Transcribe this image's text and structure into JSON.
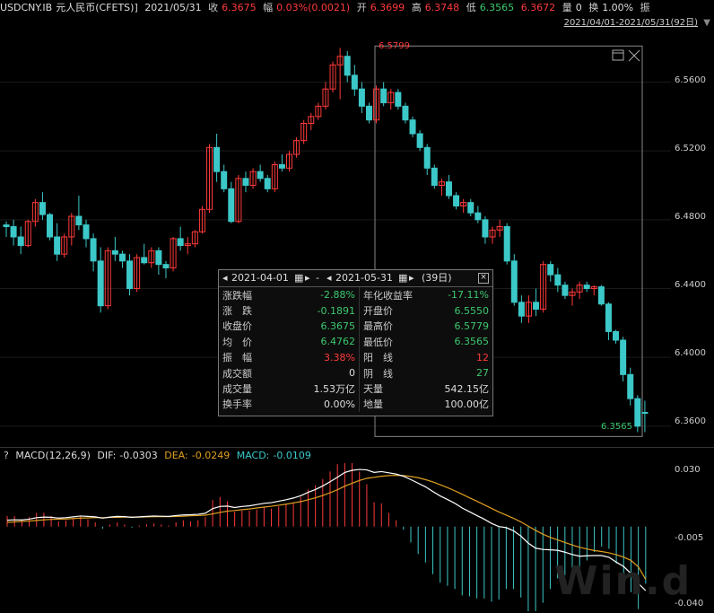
{
  "header": {
    "symbol": "USDCNY.IB",
    "name": "元人民币(CFETS)]",
    "date": "2021/05/31",
    "close_label": "收",
    "close_value": "6.3675",
    "change_label": "幅",
    "change_value": "0.03%(0.0021)",
    "open_label": "开",
    "open_value": "6.3699",
    "high_label": "高",
    "high_value": "6.3748",
    "low_label": "低",
    "low_value": "6.3565",
    "extra_value": "6.3672",
    "vol_label": "量",
    "vol_value": "0",
    "turn_label": "换",
    "turn_value": "1.00%",
    "amp_label": "振"
  },
  "range_subtitle": "2021/04/01-2021/05/31(92日)",
  "price_axis": [
    "6.5600",
    "6.5200",
    "6.4800",
    "6.4400",
    "6.4000",
    "6.3600"
  ],
  "high_marker": "6.5799",
  "low_marker": "6.3565",
  "macd_header": {
    "help": "?",
    "title": "MACD(12,26,9)",
    "dif_label": "DIF:",
    "dif_value": "-0.0303",
    "dea_label": "DEA:",
    "dea_value": "-0.0249",
    "macd_label": "MACD:",
    "macd_value": "-0.0109"
  },
  "macd_axis": [
    "0.030",
    "-0.005",
    "-0.040"
  ],
  "popup": {
    "start_date": "2021-04-01",
    "dash": "-",
    "end_date": "2021-05-31",
    "days": "(39日)",
    "rows": [
      {
        "k1": "涨跌幅",
        "v1": "-2.88%",
        "c1": "dn",
        "k2": "年化收益率",
        "v2": "-17.11%",
        "c2": "dn"
      },
      {
        "k1": "涨　跌",
        "v1": "-0.1891",
        "c1": "dn",
        "k2": "开盘价",
        "v2": "6.5550",
        "c2": "dn"
      },
      {
        "k1": "收盘价",
        "v1": "6.3675",
        "c1": "dn",
        "k2": "最高价",
        "v2": "6.5779",
        "c2": "dn"
      },
      {
        "k1": "均　价",
        "v1": "6.4762",
        "c1": "dn",
        "k2": "最低价",
        "v2": "6.3565",
        "c2": "dn"
      },
      {
        "k1": "振　幅",
        "v1": "3.38%",
        "c1": "up",
        "k2": "阳　线",
        "v2": "12",
        "c2": "up"
      },
      {
        "k1": "成交额",
        "v1": "0",
        "c1": "wht",
        "k2": "阴　线",
        "v2": "27",
        "c2": "dn"
      },
      {
        "k1": "成交量",
        "v1": "1.53万亿",
        "c1": "wht",
        "k2": "天量",
        "v2": "542.15亿",
        "c2": "wht"
      },
      {
        "k1": "换手率",
        "v1": "0.00%",
        "c1": "wht",
        "k2": "地量",
        "v2": "100.00亿",
        "c2": "wht"
      }
    ]
  },
  "watermark": "Win.d",
  "colors": {
    "up": "#ff3a3a",
    "down": "#3cc8c8",
    "dif": "#ffffff",
    "dea": "#e0a020"
  },
  "chart_data": {
    "type": "candlestick",
    "y_range": [
      6.35,
      6.59
    ],
    "candles": [
      [
        6.477,
        6.479,
        6.47,
        6.476
      ],
      [
        6.476,
        6.48,
        6.465,
        6.47
      ],
      [
        6.47,
        6.476,
        6.46,
        6.465
      ],
      [
        6.465,
        6.48,
        6.464,
        6.479
      ],
      [
        6.479,
        6.492,
        6.476,
        6.49
      ],
      [
        6.49,
        6.496,
        6.48,
        6.483
      ],
      [
        6.483,
        6.484,
        6.468,
        6.47
      ],
      [
        6.47,
        6.478,
        6.456,
        6.46
      ],
      [
        6.46,
        6.472,
        6.458,
        6.47
      ],
      [
        6.47,
        6.484,
        6.465,
        6.482
      ],
      [
        6.482,
        6.494,
        6.474,
        6.477
      ],
      [
        6.477,
        6.48,
        6.464,
        6.469
      ],
      [
        6.469,
        6.472,
        6.45,
        6.456
      ],
      [
        6.456,
        6.464,
        6.426,
        6.43
      ],
      [
        6.43,
        6.464,
        6.428,
        6.462
      ],
      [
        6.462,
        6.47,
        6.456,
        6.46
      ],
      [
        6.46,
        6.462,
        6.452,
        6.456
      ],
      [
        6.456,
        6.46,
        6.436,
        6.44
      ],
      [
        6.44,
        6.46,
        6.438,
        6.458
      ],
      [
        6.458,
        6.466,
        6.454,
        6.455
      ],
      [
        6.455,
        6.464,
        6.452,
        6.462
      ],
      [
        6.462,
        6.464,
        6.448,
        6.454
      ],
      [
        6.454,
        6.456,
        6.446,
        6.452
      ],
      [
        6.452,
        6.47,
        6.45,
        6.469
      ],
      [
        6.469,
        6.476,
        6.462,
        6.465
      ],
      [
        6.465,
        6.47,
        6.46,
        6.466
      ],
      [
        6.466,
        6.474,
        6.464,
        6.473
      ],
      [
        6.473,
        6.488,
        6.472,
        6.486
      ],
      [
        6.486,
        6.524,
        6.484,
        6.522
      ],
      [
        6.522,
        6.53,
        6.502,
        6.508
      ],
      [
        6.508,
        6.512,
        6.496,
        6.498
      ],
      [
        6.498,
        6.502,
        6.478,
        6.479
      ],
      [
        6.479,
        6.506,
        6.478,
        6.504
      ],
      [
        6.504,
        6.508,
        6.496,
        6.5
      ],
      [
        6.5,
        6.51,
        6.498,
        6.508
      ],
      [
        6.508,
        6.512,
        6.502,
        6.504
      ],
      [
        6.504,
        6.506,
        6.496,
        6.498
      ],
      [
        6.498,
        6.514,
        6.496,
        6.512
      ],
      [
        6.512,
        6.518,
        6.508,
        6.51
      ],
      [
        6.51,
        6.52,
        6.508,
        6.518
      ],
      [
        6.518,
        6.528,
        6.516,
        6.526
      ],
      [
        6.526,
        6.538,
        6.524,
        6.536
      ],
      [
        6.536,
        6.542,
        6.532,
        6.54
      ],
      [
        6.54,
        6.548,
        6.538,
        6.546
      ],
      [
        6.546,
        6.56,
        6.544,
        6.556
      ],
      [
        6.556,
        6.572,
        6.554,
        6.57
      ],
      [
        6.57,
        6.5799,
        6.55,
        6.575
      ],
      [
        6.575,
        6.578,
        6.56,
        6.564
      ],
      [
        6.564,
        6.57,
        6.552,
        6.556
      ],
      [
        6.556,
        6.56,
        6.542,
        6.546
      ],
      [
        6.546,
        6.548,
        6.536,
        6.538
      ],
      [
        6.538,
        6.558,
        6.536,
        6.556
      ],
      [
        6.556,
        6.56,
        6.546,
        6.548
      ],
      [
        6.548,
        6.556,
        6.544,
        6.554
      ],
      [
        6.554,
        6.556,
        6.544,
        6.546
      ],
      [
        6.546,
        6.548,
        6.536,
        6.538
      ],
      [
        6.538,
        6.54,
        6.528,
        6.53
      ],
      [
        6.53,
        6.532,
        6.52,
        6.522
      ],
      [
        6.522,
        6.524,
        6.506,
        6.51
      ],
      [
        6.51,
        6.512,
        6.498,
        6.5
      ],
      [
        6.5,
        6.504,
        6.494,
        6.502
      ],
      [
        6.502,
        6.506,
        6.492,
        6.494
      ],
      [
        6.494,
        6.496,
        6.486,
        6.488
      ],
      [
        6.488,
        6.492,
        6.484,
        6.49
      ],
      [
        6.49,
        6.492,
        6.482,
        6.484
      ],
      [
        6.484,
        6.488,
        6.478,
        6.48
      ],
      [
        6.48,
        6.482,
        6.466,
        6.47
      ],
      [
        6.47,
        6.476,
        6.466,
        6.474
      ],
      [
        6.474,
        6.48,
        6.47,
        6.476
      ],
      [
        6.476,
        6.478,
        6.454,
        6.456
      ],
      [
        6.456,
        6.46,
        6.43,
        6.432
      ],
      [
        6.432,
        6.436,
        6.42,
        6.424
      ],
      [
        6.424,
        6.436,
        6.42,
        6.432
      ],
      [
        6.432,
        6.44,
        6.424,
        6.428
      ],
      [
        6.428,
        6.456,
        6.426,
        6.454
      ],
      [
        6.454,
        6.456,
        6.444,
        6.448
      ],
      [
        6.448,
        6.452,
        6.438,
        6.442
      ],
      [
        6.442,
        6.444,
        6.434,
        6.436
      ],
      [
        6.436,
        6.44,
        6.43,
        6.438
      ],
      [
        6.438,
        6.444,
        6.434,
        6.442
      ],
      [
        6.442,
        6.444,
        6.438,
        6.44
      ],
      [
        6.44,
        6.442,
        6.436,
        6.441
      ],
      [
        6.441,
        6.442,
        6.43,
        6.431
      ],
      [
        6.431,
        6.432,
        6.41,
        6.415
      ],
      [
        6.415,
        6.416,
        6.408,
        6.41
      ],
      [
        6.41,
        6.412,
        6.386,
        6.39
      ],
      [
        6.39,
        6.394,
        6.372,
        6.376
      ],
      [
        6.376,
        6.378,
        6.3565,
        6.36
      ],
      [
        6.368,
        6.3748,
        6.3565,
        6.3675
      ]
    ],
    "macd": {
      "dif": [
        0.003,
        0.0032,
        0.0031,
        0.0035,
        0.0042,
        0.0045,
        0.0044,
        0.004,
        0.0042,
        0.0046,
        0.005,
        0.0048,
        0.0046,
        0.004,
        0.0045,
        0.0048,
        0.0047,
        0.0044,
        0.0046,
        0.0048,
        0.005,
        0.0049,
        0.0048,
        0.0052,
        0.0055,
        0.0056,
        0.0058,
        0.0063,
        0.0085,
        0.0095,
        0.0097,
        0.009,
        0.0095,
        0.0098,
        0.0104,
        0.011,
        0.0113,
        0.012,
        0.0127,
        0.0135,
        0.0146,
        0.0162,
        0.0175,
        0.0192,
        0.0212,
        0.0233,
        0.0256,
        0.0266,
        0.027,
        0.0268,
        0.0256,
        0.026,
        0.0254,
        0.0248,
        0.0238,
        0.0222,
        0.0205,
        0.0188,
        0.0166,
        0.0145,
        0.0128,
        0.011,
        0.0088,
        0.007,
        0.0052,
        0.0035,
        0.0015,
        0.0,
        -0.0005,
        -0.002,
        -0.0045,
        -0.0078,
        -0.0102,
        -0.0108,
        -0.011,
        -0.0112,
        -0.0121,
        -0.0132,
        -0.014,
        -0.0138,
        -0.0137,
        -0.0137,
        -0.0145,
        -0.0168,
        -0.0189,
        -0.0222,
        -0.0268,
        -0.0303
      ],
      "dea": [
        0.002,
        0.0022,
        0.0024,
        0.0026,
        0.0029,
        0.0032,
        0.0034,
        0.0035,
        0.0036,
        0.0038,
        0.004,
        0.0041,
        0.0042,
        0.0042,
        0.0043,
        0.0044,
        0.0045,
        0.0045,
        0.0045,
        0.0046,
        0.0047,
        0.0047,
        0.0047,
        0.0048,
        0.0049,
        0.0051,
        0.0052,
        0.0054,
        0.006,
        0.0067,
        0.0073,
        0.0076,
        0.008,
        0.0083,
        0.0088,
        0.0092,
        0.0096,
        0.0101,
        0.0106,
        0.0112,
        0.0118,
        0.0127,
        0.0136,
        0.0147,
        0.016,
        0.0174,
        0.0191,
        0.0205,
        0.0218,
        0.0228,
        0.0233,
        0.0238,
        0.0241,
        0.0242,
        0.0241,
        0.0237,
        0.0231,
        0.0222,
        0.0211,
        0.0198,
        0.0184,
        0.0169,
        0.0153,
        0.0136,
        0.012,
        0.0103,
        0.0086,
        0.0069,
        0.0054,
        0.0039,
        0.0022,
        0.0002,
        -0.0018,
        -0.0036,
        -0.0051,
        -0.0063,
        -0.0075,
        -0.0087,
        -0.0098,
        -0.0106,
        -0.0113,
        -0.0118,
        -0.0124,
        -0.0133,
        -0.0144,
        -0.016,
        -0.019,
        -0.0249
      ]
    },
    "macd_range": [
      -0.04,
      0.03
    ]
  }
}
